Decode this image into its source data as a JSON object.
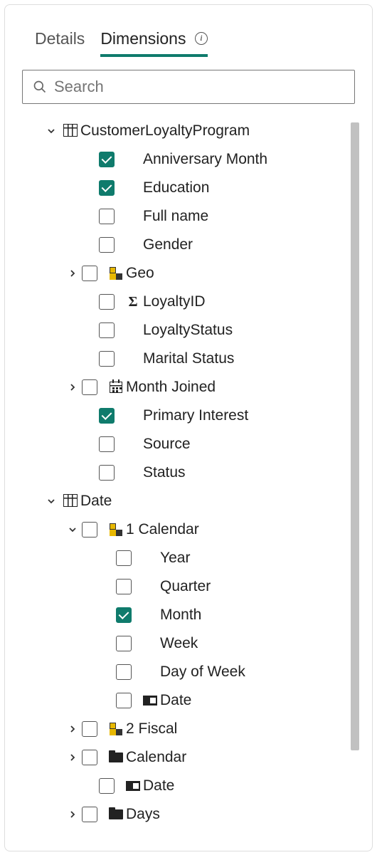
{
  "tabs": {
    "details": "Details",
    "dimensions": "Dimensions"
  },
  "search": {
    "placeholder": "Search"
  },
  "tree": [
    {
      "level": 0,
      "caret": "down",
      "checkbox": null,
      "icon": "table",
      "label": "CustomerLoyaltyProgram"
    },
    {
      "level": 1,
      "caret": "none",
      "checkbox": true,
      "icon": null,
      "label": "Anniversary Month"
    },
    {
      "level": 1,
      "caret": "none",
      "checkbox": true,
      "icon": null,
      "label": "Education"
    },
    {
      "level": 1,
      "caret": "none",
      "checkbox": false,
      "icon": null,
      "label": "Full name"
    },
    {
      "level": 1,
      "caret": "none",
      "checkbox": false,
      "icon": null,
      "label": "Gender"
    },
    {
      "level": 1,
      "caret": "right",
      "checkbox": false,
      "icon": "hier",
      "label": "Geo"
    },
    {
      "level": 1,
      "caret": "none",
      "checkbox": false,
      "icon": "sigma",
      "label": "LoyaltyID"
    },
    {
      "level": 1,
      "caret": "none",
      "checkbox": false,
      "icon": null,
      "label": "LoyaltyStatus"
    },
    {
      "level": 1,
      "caret": "none",
      "checkbox": false,
      "icon": null,
      "label": "Marital Status"
    },
    {
      "level": 1,
      "caret": "right",
      "checkbox": false,
      "icon": "cal",
      "label": "Month Joined"
    },
    {
      "level": 1,
      "caret": "none",
      "checkbox": true,
      "icon": null,
      "label": "Primary Interest"
    },
    {
      "level": 1,
      "caret": "none",
      "checkbox": false,
      "icon": null,
      "label": "Source"
    },
    {
      "level": 1,
      "caret": "none",
      "checkbox": false,
      "icon": null,
      "label": "Status"
    },
    {
      "level": 0,
      "caret": "down",
      "checkbox": null,
      "icon": "table",
      "label": "Date"
    },
    {
      "level": 1,
      "caret": "down",
      "checkbox": false,
      "icon": "hier",
      "label": "1 Calendar"
    },
    {
      "level": 2,
      "caret": "none",
      "checkbox": false,
      "icon": null,
      "label": "Year"
    },
    {
      "level": 2,
      "caret": "none",
      "checkbox": false,
      "icon": null,
      "label": "Quarter"
    },
    {
      "level": 2,
      "caret": "none",
      "checkbox": true,
      "icon": null,
      "label": "Month"
    },
    {
      "level": 2,
      "caret": "none",
      "checkbox": false,
      "icon": null,
      "label": "Week"
    },
    {
      "level": 2,
      "caret": "none",
      "checkbox": false,
      "icon": null,
      "label": "Day of Week"
    },
    {
      "level": 2,
      "caret": "none",
      "checkbox": false,
      "icon": "detail",
      "label": "Date"
    },
    {
      "level": 1,
      "caret": "right",
      "checkbox": false,
      "icon": "hier",
      "label": "2 Fiscal"
    },
    {
      "level": 1,
      "caret": "right",
      "checkbox": false,
      "icon": "folder",
      "label": "Calendar"
    },
    {
      "level": 1,
      "caret": "none",
      "checkbox": false,
      "icon": "detail",
      "label": "Date"
    },
    {
      "level": 1,
      "caret": "right",
      "checkbox": false,
      "icon": "folder",
      "label": "Days"
    }
  ]
}
